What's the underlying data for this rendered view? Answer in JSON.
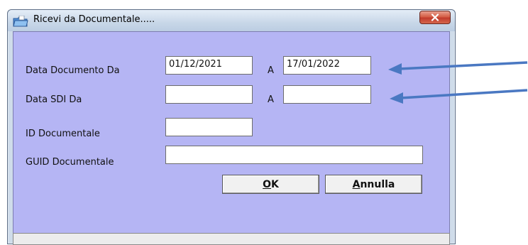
{
  "window": {
    "title": "Ricevi da Documentale.....",
    "icons": {
      "title_icon": "folder-icon",
      "close_icon": "close-icon"
    },
    "colors": {
      "client_bg": "#b5b5f4",
      "close_button": "#c0392b",
      "arrow": "#4a78c2"
    }
  },
  "form": {
    "data_documento_label": "Data Documento  Da",
    "data_documento_da": "01/12/2021",
    "a_label_1": "A",
    "data_documento_a": "17/01/2022",
    "data_sdi_label": "Data SDI  Da",
    "data_sdi_da": "",
    "a_label_2": "A",
    "data_sdi_a": "",
    "id_documentale_label": "ID Documentale",
    "id_documentale": "",
    "guid_documentale_label": "GUID Documentale",
    "guid_documentale": ""
  },
  "buttons": {
    "ok": {
      "mnemonic": "O",
      "rest": "K"
    },
    "annulla": {
      "mnemonic": "A",
      "rest": "nnulla"
    }
  },
  "status": {
    "text": ""
  }
}
